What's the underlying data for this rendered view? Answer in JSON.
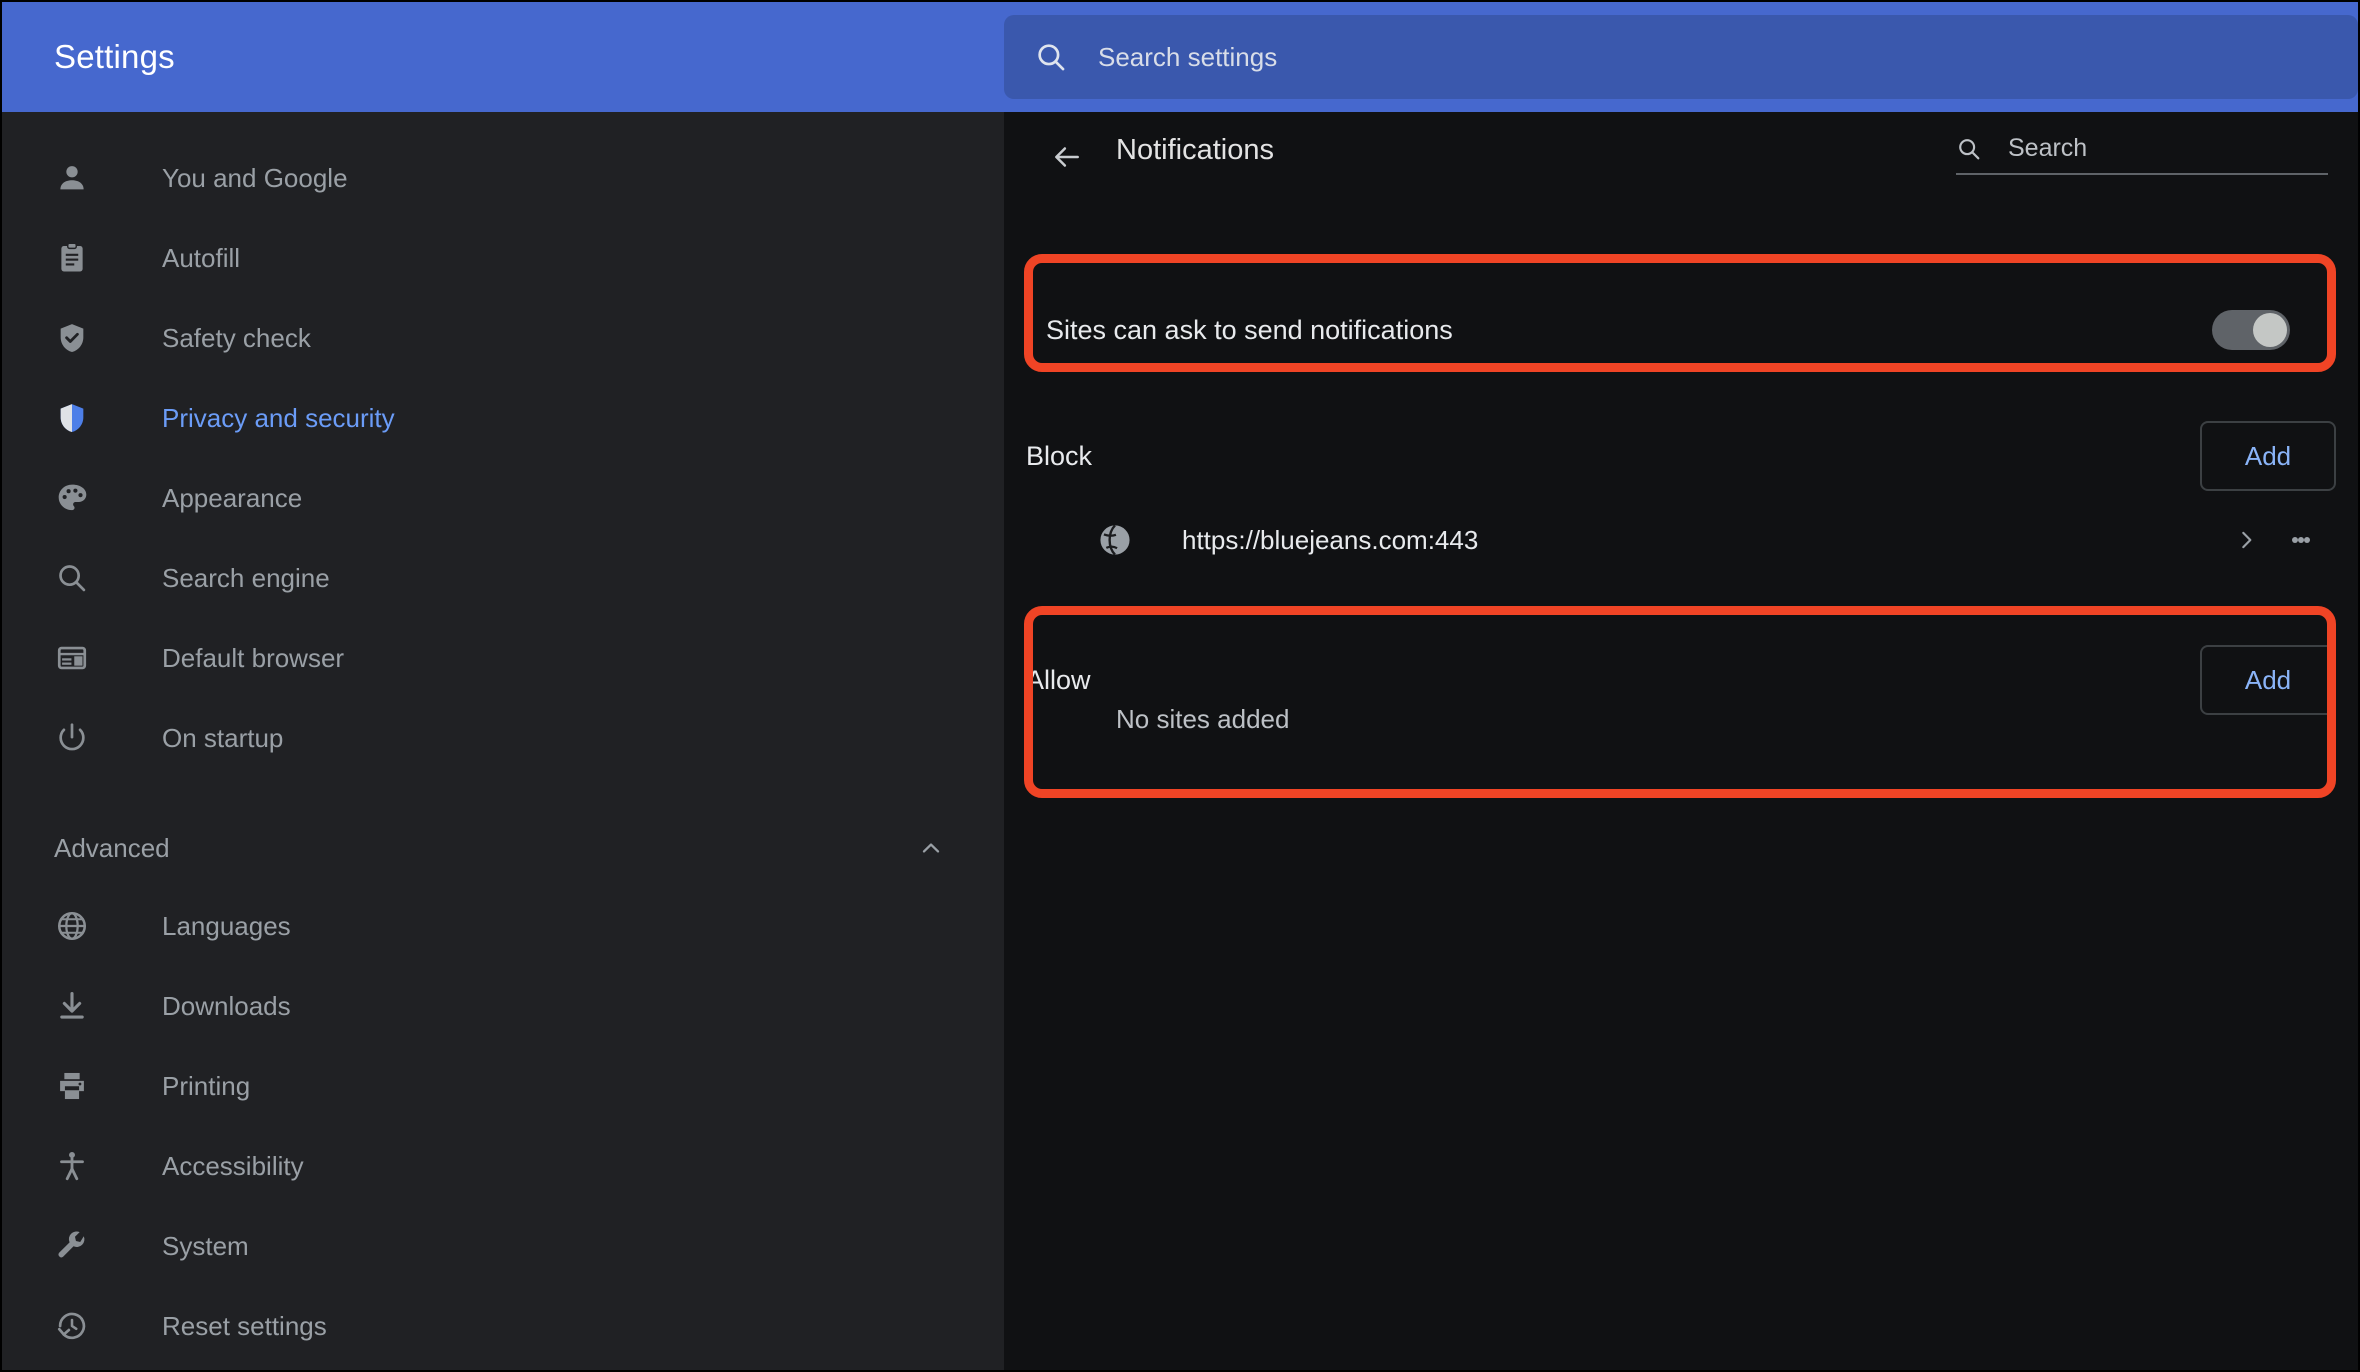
{
  "window": {
    "app_title": "Settings",
    "accent_color": "#4668ce",
    "highlight_color": "#f04425",
    "link_color": "#8ab4f8"
  },
  "global_search": {
    "placeholder": "Search settings",
    "icon": "search-icon",
    "value": ""
  },
  "sidebar": {
    "items": [
      {
        "label": "You and Google",
        "icon": "person-icon",
        "active": false
      },
      {
        "label": "Autofill",
        "icon": "clipboard-icon",
        "active": false
      },
      {
        "label": "Safety check",
        "icon": "shield-check-icon",
        "active": false
      },
      {
        "label": "Privacy and security",
        "icon": "shield-icon",
        "active": true
      },
      {
        "label": "Appearance",
        "icon": "palette-icon",
        "active": false
      },
      {
        "label": "Search engine",
        "icon": "search-icon",
        "active": false
      },
      {
        "label": "Default browser",
        "icon": "browser-window-icon",
        "active": false
      },
      {
        "label": "On startup",
        "icon": "power-icon",
        "active": false
      }
    ],
    "advanced": {
      "label": "Advanced",
      "icon": "chevron-up-icon",
      "expanded": true,
      "items": [
        {
          "label": "Languages",
          "icon": "globe-icon"
        },
        {
          "label": "Downloads",
          "icon": "download-icon"
        },
        {
          "label": "Printing",
          "icon": "printer-icon"
        },
        {
          "label": "Accessibility",
          "icon": "accessibility-icon"
        },
        {
          "label": "System",
          "icon": "wrench-icon"
        },
        {
          "label": "Reset settings",
          "icon": "history-icon"
        }
      ]
    }
  },
  "main": {
    "back_icon": "arrow-left-icon",
    "page_title": "Notifications",
    "search": {
      "placeholder": "Search",
      "icon": "search-icon",
      "value": ""
    },
    "permission_toggle": {
      "label": "Sites can ask to send notifications",
      "state": "off"
    },
    "block": {
      "title": "Block",
      "add_label": "Add",
      "sites": [
        {
          "url": "https://bluejeans.com:443",
          "icon": "globe-icon",
          "expand_icon": "chevron-right-icon",
          "menu_icon": "more-vertical-icon"
        }
      ]
    },
    "allow": {
      "title": "Allow",
      "add_label": "Add",
      "empty_text": "No sites added",
      "sites": []
    }
  }
}
